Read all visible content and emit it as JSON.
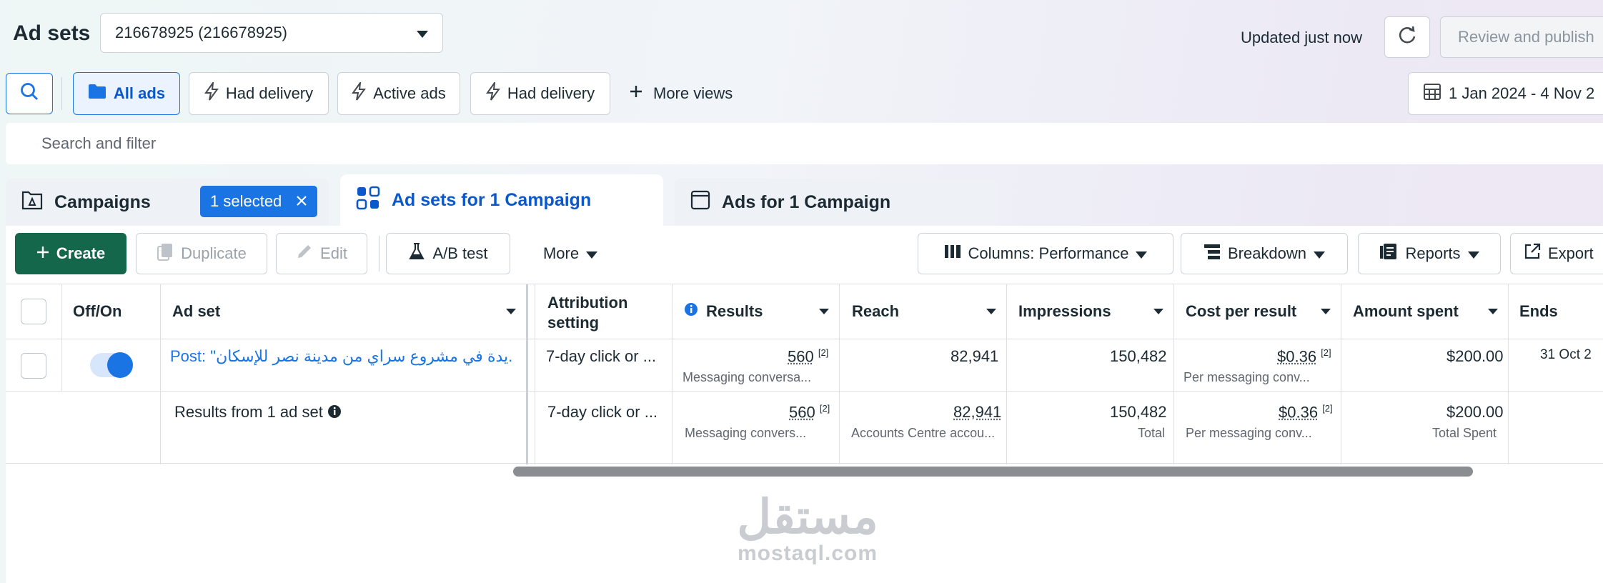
{
  "header": {
    "title": "Ad sets",
    "account": "216678925 (216678925)",
    "updated": "Updated just now",
    "review_button": "Review and publish"
  },
  "views": {
    "all_ads": "All ads",
    "had_delivery_1": "Had delivery",
    "active_ads": "Active ads",
    "had_delivery_2": "Had delivery",
    "more_views": "More views",
    "date_range": "1 Jan 2024 - 4 Nov 2"
  },
  "search": {
    "placeholder": "Search and filter"
  },
  "tabs": {
    "campaigns": "Campaigns",
    "selected_chip": "1 selected",
    "ad_sets": "Ad sets for 1 Campaign",
    "ads": "Ads for 1 Campaign"
  },
  "toolbar": {
    "create": "Create",
    "duplicate": "Duplicate",
    "edit": "Edit",
    "ab_test": "A/B test",
    "more": "More",
    "columns": "Columns: Performance",
    "breakdown": "Breakdown",
    "reports": "Reports",
    "export": "Export"
  },
  "table": {
    "headers": {
      "off_on": "Off/On",
      "ad_set": "Ad set",
      "attribution": "Attribution setting",
      "results": "Results",
      "reach": "Reach",
      "impressions": "Impressions",
      "cost_per_result": "Cost per result",
      "amount_spent": "Amount spent",
      "ends": "Ends"
    },
    "row": {
      "ad_set": "Post: \"يدة في مشروع سراي من مدينة نصر للإسكان...",
      "attribution": "7-day click or ...",
      "results": "560",
      "results_note": "[2]",
      "results_sub": "Messaging conversa...",
      "reach": "82,941",
      "impressions": "150,482",
      "cost": "$0.36",
      "cost_note": "[2]",
      "cost_sub": "Per messaging conv...",
      "amount": "$200.00",
      "ends": "31 Oct 2"
    },
    "summary": {
      "label": "Results from 1 ad set",
      "attribution": "7-day click or ...",
      "results": "560",
      "results_note": "[2]",
      "results_sub": "Messaging convers...",
      "reach": "82,941",
      "reach_sub": "Accounts Centre accou...",
      "impressions": "150,482",
      "impressions_sub": "Total",
      "cost": "$0.36",
      "cost_note": "[2]",
      "cost_sub": "Per messaging conv...",
      "amount": "$200.00",
      "amount_sub": "Total Spent"
    }
  },
  "watermark": {
    "arabic": "مستقل",
    "latin": "mostaql.com"
  }
}
